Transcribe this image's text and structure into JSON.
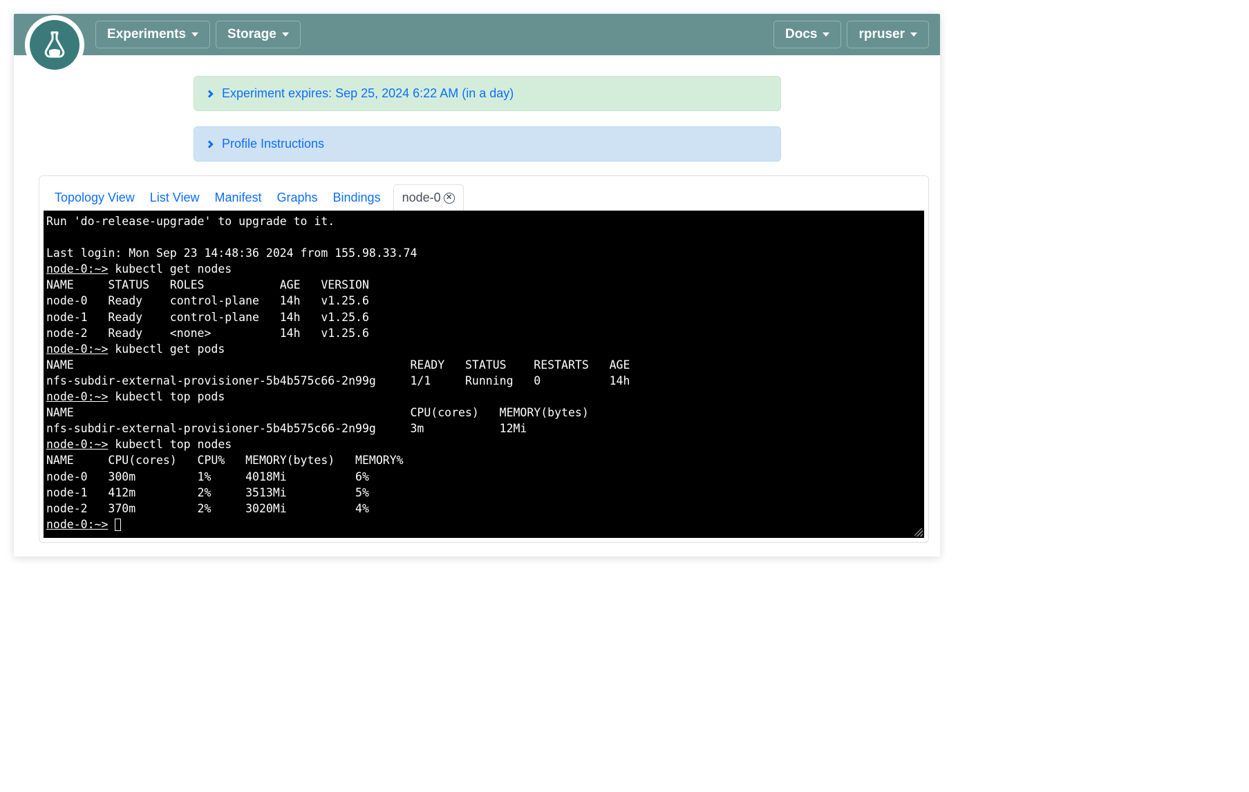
{
  "nav": {
    "experiments": "Experiments",
    "storage": "Storage",
    "docs": "Docs",
    "user": "rpruser"
  },
  "alerts": {
    "expires": "Experiment expires: Sep 25, 2024 6:22 AM (in a day)",
    "profile": "Profile Instructions"
  },
  "tabs": {
    "topology": "Topology View",
    "list": "List View",
    "manifest": "Manifest",
    "graphs": "Graphs",
    "bindings": "Bindings",
    "node0": "node-0"
  },
  "terminal": {
    "line_upgrade": "Run 'do-release-upgrade' to upgrade to it.",
    "line_lastlogin": "Last login: Mon Sep 23 14:48:36 2024 from 155.98.33.74",
    "prompt": "node-0:~>",
    "cmd_get_nodes": " kubectl get nodes",
    "hdr_nodes": "NAME     STATUS   ROLES           AGE   VERSION",
    "row_node0": "node-0   Ready    control-plane   14h   v1.25.6",
    "row_node1": "node-1   Ready    control-plane   14h   v1.25.6",
    "row_node2": "node-2   Ready    <none>          14h   v1.25.6",
    "cmd_get_pods": " kubectl get pods",
    "hdr_pods": "NAME                                                 READY   STATUS    RESTARTS   AGE",
    "row_pod": "nfs-subdir-external-provisioner-5b4b575c66-2n99g     1/1     Running   0          14h",
    "cmd_top_pods": " kubectl top pods",
    "hdr_top_pods": "NAME                                                 CPU(cores)   MEMORY(bytes)",
    "row_top_pod": "nfs-subdir-external-provisioner-5b4b575c66-2n99g     3m           12Mi",
    "cmd_top_nodes": " kubectl top nodes",
    "hdr_top_nodes": "NAME     CPU(cores)   CPU%   MEMORY(bytes)   MEMORY%",
    "row_tn0": "node-0   300m         1%     4018Mi          6%",
    "row_tn1": "node-1   412m         2%     3513Mi          5%",
    "row_tn2": "node-2   370m         2%     3020Mi          4%"
  }
}
